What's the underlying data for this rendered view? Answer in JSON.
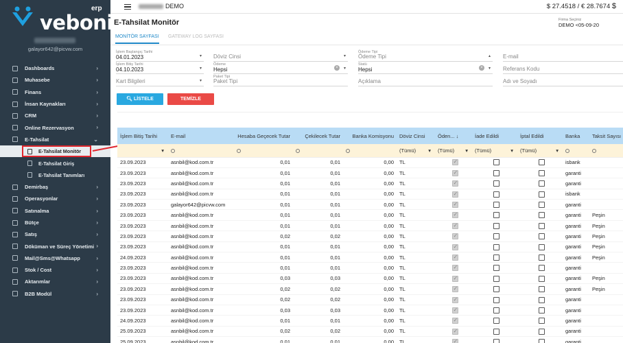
{
  "brand": {
    "name": "veboni",
    "suffix": "erp"
  },
  "user": {
    "email": "galayor642@picvw.com"
  },
  "topbar": {
    "company": "DEMO",
    "rates": "$ 27.4518 / € 28.7674"
  },
  "sidebar": {
    "items": [
      {
        "label": "Dashboards",
        "chev": true
      },
      {
        "label": "Muhasebe",
        "chev": true
      },
      {
        "label": "Finans",
        "chev": true
      },
      {
        "label": "İnsan Kaynakları",
        "chev": true
      },
      {
        "label": "CRM",
        "chev": true
      },
      {
        "label": "Online Rezervasyon",
        "chev": true
      },
      {
        "label": "E-Tahsilat",
        "chev": true,
        "open": true
      },
      {
        "label": "E-Tahsilat Monitör",
        "sub": true,
        "active": true
      },
      {
        "label": "E-Tahsilat Giriş",
        "sub": true
      },
      {
        "label": "E-Tahsilat Tanımları",
        "sub": true
      },
      {
        "label": "Demirbaş",
        "chev": true
      },
      {
        "label": "Operasyonlar",
        "chev": true
      },
      {
        "label": "Satınalma",
        "chev": true
      },
      {
        "label": "Bütçe",
        "chev": true
      },
      {
        "label": "Satış",
        "chev": true
      },
      {
        "label": "Döküman ve Süreç Yönetimi",
        "chev": true
      },
      {
        "label": "Mail@Sms@Whatsapp",
        "chev": true
      },
      {
        "label": "Stok / Cost",
        "chev": true
      },
      {
        "label": "Aktarımlar",
        "chev": true
      },
      {
        "label": "B2B Modül",
        "chev": true
      }
    ]
  },
  "page": {
    "title": "E-Tahsilat Monitör",
    "firm_label": "Firma Seçiniz",
    "firm_value": "DEMO <05-09-20",
    "tabs": [
      "MONİTÖR SAYFASI",
      "GATEWAY LOG SAYFASI"
    ]
  },
  "filters": {
    "start_label": "İşlem Başlangıç Tarihi",
    "start_value": "04.01.2023",
    "currency_ph": "Döviz Cinsi",
    "paytype_label": "Ödeme Tipi",
    "paytype_ph": "Ödeme Tipi",
    "email_ph": "E-mail",
    "end_label": "İşlem Bitiş Tarihi",
    "end_value": "04.10.2023",
    "paid_label": "Ödeme",
    "paid_value": "Hepsi",
    "status_label": "Statü",
    "status_value": "Hepsi",
    "ref_ph": "Referans Kodu",
    "card_ph": "Kart Bilgileri",
    "pkg_label": "Paket Tipi",
    "pkg_ph": "Paket Tipi",
    "desc_ph": "Açıklama",
    "name_ph": "Adı ve Soyadı",
    "list_btn": "LİSTELE",
    "clear_btn": "TEMİZLE"
  },
  "grid": {
    "columns": [
      "İşlem Bitiş Tarihi",
      "E-mail",
      "Hesaba Geçecek Tutar",
      "Çekilecek Tutar",
      "Banka Komisyonu",
      "Döviz Cinsi",
      "Öden... ↓",
      "İade Edildi",
      "İptal Edildi",
      "Banka",
      "Taksit Sayısı"
    ],
    "filter_all": "(Tümü)",
    "rows": [
      [
        "23.09.2023",
        "asnbil@kod.com.tr",
        "0,01",
        "0,01",
        "0,00",
        "TL",
        "",
        "",
        "",
        "isbank",
        ""
      ],
      [
        "23.09.2023",
        "asnbil@kod.com.tr",
        "0,01",
        "0,01",
        "0,00",
        "TL",
        "",
        "",
        "",
        "garanti",
        ""
      ],
      [
        "23.09.2023",
        "asnbil@kod.com.tr",
        "0,01",
        "0,01",
        "0,00",
        "TL",
        "",
        "",
        "",
        "garanti",
        ""
      ],
      [
        "23.09.2023",
        "asnbil@kod.com.tr",
        "0,01",
        "0,01",
        "0,00",
        "TL",
        "",
        "",
        "",
        "isbank",
        ""
      ],
      [
        "23.09.2023",
        "galayor642@picvw.com",
        "0,01",
        "0,01",
        "0,00",
        "TL",
        "",
        "",
        "",
        "garanti",
        ""
      ],
      [
        "23.09.2023",
        "asnbil@kod.com.tr",
        "0,01",
        "0,01",
        "0,00",
        "TL",
        "",
        "",
        "",
        "garanti",
        "Peşin"
      ],
      [
        "23.09.2023",
        "asnbil@kod.com.tr",
        "0,01",
        "0,01",
        "0,00",
        "TL",
        "",
        "",
        "",
        "garanti",
        "Peşin"
      ],
      [
        "23.09.2023",
        "asnbil@kod.com.tr",
        "0,02",
        "0,02",
        "0,00",
        "TL",
        "",
        "",
        "",
        "garanti",
        "Peşin"
      ],
      [
        "23.09.2023",
        "asnbil@kod.com.tr",
        "0,01",
        "0,01",
        "0,00",
        "TL",
        "",
        "",
        "",
        "garanti",
        "Peşin"
      ],
      [
        "24.09.2023",
        "asnbil@kod.com.tr",
        "0,01",
        "0,01",
        "0,00",
        "TL",
        "",
        "",
        "",
        "garanti",
        "Peşin"
      ],
      [
        "23.09.2023",
        "asnbil@kod.com.tr",
        "0,01",
        "0,01",
        "0,00",
        "TL",
        "",
        "",
        "",
        "garanti",
        ""
      ],
      [
        "23.09.2023",
        "asnbil@kod.com.tr",
        "0,03",
        "0,03",
        "0,00",
        "TL",
        "",
        "",
        "",
        "garanti",
        "Peşin"
      ],
      [
        "23.09.2023",
        "asnbil@kod.com.tr",
        "0,02",
        "0,02",
        "0,00",
        "TL",
        "",
        "",
        "",
        "garanti",
        "Peşin"
      ],
      [
        "23.09.2023",
        "asnbil@kod.com.tr",
        "0,02",
        "0,02",
        "0,00",
        "TL",
        "",
        "",
        "",
        "garanti",
        ""
      ],
      [
        "23.09.2023",
        "asnbil@kod.com.tr",
        "0,03",
        "0,03",
        "0,00",
        "TL",
        "",
        "",
        "",
        "garanti",
        ""
      ],
      [
        "24.09.2023",
        "asnbil@kod.com.tr",
        "0,01",
        "0,01",
        "0,00",
        "TL",
        "",
        "",
        "",
        "garanti",
        ""
      ],
      [
        "25.09.2023",
        "asnbil@kod.com.tr",
        "0,02",
        "0,02",
        "0,00",
        "TL",
        "",
        "",
        "",
        "garanti",
        ""
      ],
      [
        "25.09.2023",
        "asnbil@kod.com.tr",
        "0,01",
        "0,01",
        "0,00",
        "TL",
        "",
        "",
        "",
        "garanti",
        ""
      ]
    ]
  },
  "colors": {
    "sidebar": "#2c3b48",
    "accent": "#1e88c8",
    "list_btn": "#29a8e0",
    "clear_btn": "#ea4a46",
    "header_bg": "#b9dcf5",
    "filter_bg": "#fdf3d9",
    "highlight": "#e1262d"
  }
}
